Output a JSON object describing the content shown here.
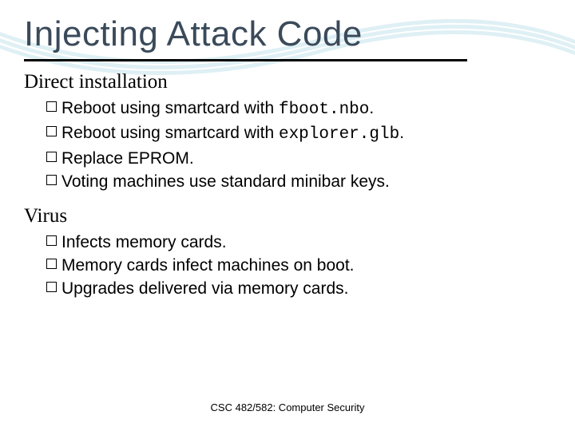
{
  "title": "Injecting Attack Code",
  "sections": [
    {
      "heading": "Direct installation",
      "bullets": [
        {
          "pre": "Reboot using smartcard with ",
          "code": "fboot.nbo",
          "post": "."
        },
        {
          "pre": "Reboot using smartcard with ",
          "code": "explorer.glb",
          "post": "."
        },
        {
          "pre": "Replace EPROM.",
          "code": "",
          "post": ""
        },
        {
          "pre": "Voting machines use standard minibar keys.",
          "code": "",
          "post": ""
        }
      ]
    },
    {
      "heading": "Virus",
      "bullets": [
        {
          "pre": "Infects memory cards.",
          "code": "",
          "post": ""
        },
        {
          "pre": "Memory cards infect machines on boot.",
          "code": "",
          "post": ""
        },
        {
          "pre": "Upgrades delivered via memory cards.",
          "code": "",
          "post": ""
        }
      ]
    }
  ],
  "footer": "CSC 482/582: Computer Security"
}
